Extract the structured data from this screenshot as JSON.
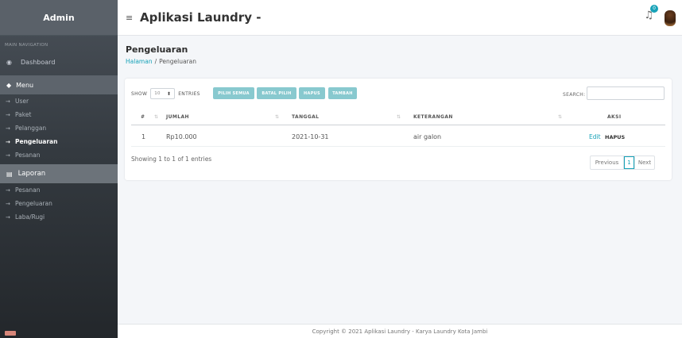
{
  "sidebar": {
    "brand": "Admin",
    "nav_header": "MAIN NAVIGATION",
    "dashboard": "Dashboard",
    "menu_label": "Menu",
    "menu_items": [
      {
        "label": "User",
        "active": false
      },
      {
        "label": "Paket",
        "active": false
      },
      {
        "label": "Pelanggan",
        "active": false
      },
      {
        "label": "Pengeluaran",
        "active": true
      },
      {
        "label": "Pesanan",
        "active": false
      }
    ],
    "laporan_label": "Laporan",
    "laporan_items": [
      {
        "label": "Pesanan"
      },
      {
        "label": "Pengeluaran"
      },
      {
        "label": "Laba/Rugi"
      }
    ]
  },
  "topbar": {
    "menu_icon": "≡",
    "title": "Aplikasi Laundry -",
    "notification_count": "0"
  },
  "content": {
    "page_title": "Pengeluaran",
    "breadcrumb_home": "Halaman",
    "breadcrumb_sep": "/",
    "breadcrumb_current": "Pengeluaran"
  },
  "table_controls": {
    "show_label": "SHOW",
    "entries_value": "10",
    "entries_label": "ENTRIES",
    "buttons": [
      "PILIH SEMUA",
      "BATAL PILIH",
      "HAPUS",
      "TAMBAH"
    ],
    "search_label": "SEARCH:",
    "search_value": ""
  },
  "table": {
    "headers": {
      "no": "#",
      "jumlah": "JUMLAH",
      "tanggal": "TANGGAL",
      "keterangan": "KETERANGAN",
      "aksi": "AKSI"
    },
    "rows": [
      {
        "no": "1",
        "jumlah": "Rp10.000",
        "tanggal": "2021-10-31",
        "keterangan": "air galon",
        "edit": "Edit",
        "hapus": "HAPUS"
      }
    ],
    "info": "Showing 1 to 1 of 1 entries",
    "pagination": {
      "previous": "Previous",
      "current": "1",
      "next": "Next"
    }
  },
  "footer": {
    "text": "Copyright © 2021 Aplikasi Laundry - Karya Laundry Kota Jambi"
  },
  "colors": {
    "accent": "#17a2b8",
    "button": "#88c9cf",
    "sidebar": "#343a40"
  }
}
